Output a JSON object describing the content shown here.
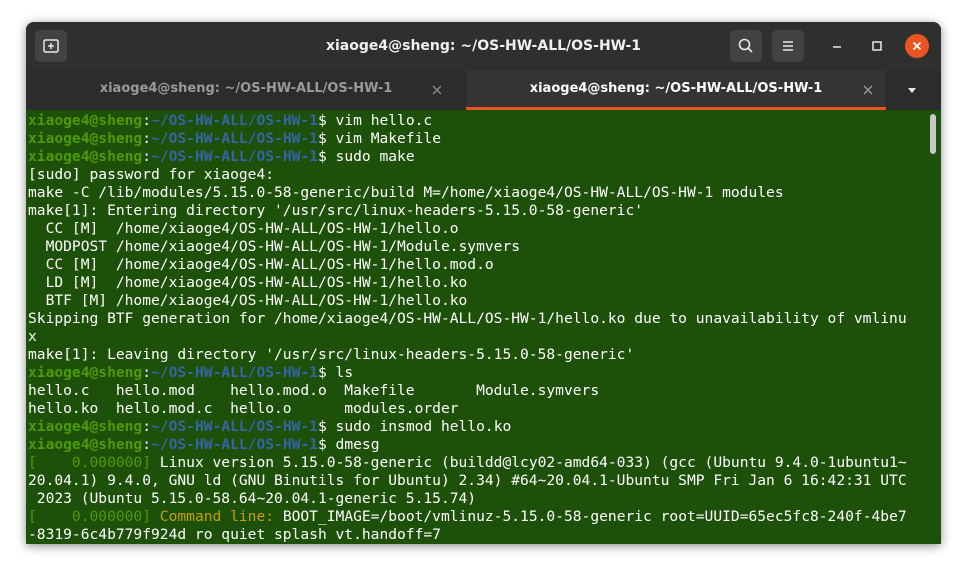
{
  "window": {
    "title": "xiaoge4@sheng: ~/OS-HW-ALL/OS-HW-1"
  },
  "tabs": [
    {
      "label": "xiaoge4@sheng: ~/OS-HW-ALL/OS-HW-1",
      "active": false
    },
    {
      "label": "xiaoge4@sheng: ~/OS-HW-ALL/OS-HW-1",
      "active": true
    }
  ],
  "icons": {
    "new_tab": "new-tab-icon",
    "search": "search-icon",
    "menu": "hamburger-menu-icon",
    "minimize": "minimize-icon",
    "maximize": "maximize-icon",
    "close": "close-icon",
    "tab_close": "close-icon",
    "tab_dropdown": "chevron-down-icon"
  },
  "colors": {
    "terminal_bg": "#1d5009",
    "prompt_user": "#4e9a06",
    "prompt_path": "#3465a4",
    "dmesg_highlight": "#c4a000",
    "close_button": "#e95420",
    "active_tab_accent": "#e95420"
  },
  "prompt": {
    "user": "xiaoge4@sheng",
    "sep": ":",
    "path": "~/OS-HW-ALL/OS-HW-1",
    "symbol": "$ "
  },
  "terminal": {
    "cmd_vim_c": "vim hello.c",
    "cmd_vim_make": "vim Makefile",
    "cmd_sudo_make": "sudo make",
    "l_sudo": "[sudo] password for xiaoge4:",
    "l_make_c": "make -C /lib/modules/5.15.0-58-generic/build M=/home/xiaoge4/OS-HW-ALL/OS-HW-1 modules",
    "l_enter": "make[1]: Entering directory '/usr/src/linux-headers-5.15.0-58-generic'",
    "l_cc1": "  CC [M]  /home/xiaoge4/OS-HW-ALL/OS-HW-1/hello.o",
    "l_modpost": "  MODPOST /home/xiaoge4/OS-HW-ALL/OS-HW-1/Module.symvers",
    "l_cc2": "  CC [M]  /home/xiaoge4/OS-HW-ALL/OS-HW-1/hello.mod.o",
    "l_ld": "  LD [M]  /home/xiaoge4/OS-HW-ALL/OS-HW-1/hello.ko",
    "l_btf": "  BTF [M] /home/xiaoge4/OS-HW-ALL/OS-HW-1/hello.ko",
    "l_skip1": "Skipping BTF generation for /home/xiaoge4/OS-HW-ALL/OS-HW-1/hello.ko due to unavailability of vmlinu",
    "l_skip2": "x",
    "l_leave": "make[1]: Leaving directory '/usr/src/linux-headers-5.15.0-58-generic'",
    "cmd_ls": "ls",
    "l_ls1": "hello.c   hello.mod    hello.mod.o  Makefile       Module.symvers",
    "l_ls2": "hello.ko  hello.mod.c  hello.o      modules.order",
    "cmd_insmod": "sudo insmod hello.ko",
    "cmd_dmesg": "dmesg",
    "d1_ts": "[    0.000000]",
    "d1_text": " Linux version 5.15.0-58-generic (buildd@lcy02-amd64-033) (gcc (Ubuntu 9.4.0-1ubuntu1~",
    "d1_l2": "20.04.1) 9.4.0, GNU ld (GNU Binutils for Ubuntu) 2.34) #64~20.04.1-Ubuntu SMP Fri Jan 6 16:42:31 UTC",
    "d1_l3": " 2023 (Ubuntu 5.15.0-58.64~20.04.1-generic 5.15.74)",
    "d2_ts": "[    0.000000]",
    "d2_key": " Command line:",
    "d2_text": " BOOT_IMAGE=/boot/vmlinuz-5.15.0-58-generic root=UUID=65ec5fc8-240f-4be7",
    "d2_l2": "-8319-6c4b779f924d ro quiet splash vt.handoff=7"
  }
}
